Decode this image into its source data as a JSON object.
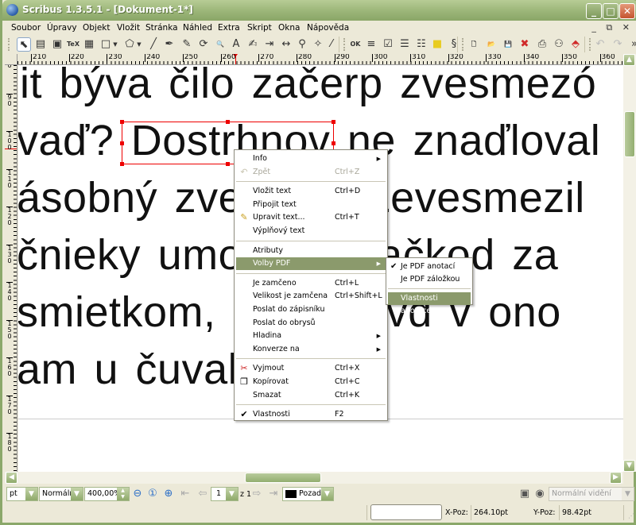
{
  "window": {
    "title": "Scribus 1.3.5.1 - [Dokument-1*]",
    "controls": {
      "minimize": "_",
      "maximize": "□",
      "close": "✕"
    },
    "mdi_controls": [
      "_",
      "⧉",
      "✕"
    ]
  },
  "menubar": [
    "Soubor",
    "Úpravy",
    "Objekt",
    "Vložit",
    "Stránka",
    "Náhled",
    "Extra",
    "Skript",
    "Okna",
    "Nápověda"
  ],
  "toolbar": {
    "tools": [
      {
        "name": "select-icon",
        "glyph": "⬉"
      },
      {
        "name": "text-frame-icon",
        "glyph": "▤"
      },
      {
        "name": "image-frame-icon",
        "glyph": "▣"
      },
      {
        "name": "latex-frame-icon",
        "glyph": "TeX"
      },
      {
        "name": "table-icon",
        "glyph": "▦"
      },
      {
        "name": "shape-icon",
        "glyph": "□"
      },
      {
        "name": "polygon-icon",
        "glyph": "⬠"
      },
      {
        "name": "line-icon",
        "glyph": "╱"
      },
      {
        "name": "bezier-icon",
        "glyph": "✒"
      },
      {
        "name": "freehand-icon",
        "glyph": "✎"
      },
      {
        "name": "rotate-icon",
        "glyph": "⟳"
      },
      {
        "name": "zoom-icon",
        "glyph": "🔍"
      },
      {
        "name": "edit-contents-icon",
        "glyph": "A"
      },
      {
        "name": "story-editor-icon",
        "glyph": "✍"
      },
      {
        "name": "link-frames-icon",
        "glyph": "⇥"
      },
      {
        "name": "unlink-frames-icon",
        "glyph": "↔"
      },
      {
        "name": "measure-icon",
        "glyph": "⚲"
      },
      {
        "name": "copy-properties-icon",
        "glyph": "✧"
      },
      {
        "name": "eyedropper-icon",
        "glyph": "⁄"
      },
      {
        "name": "pdf-button-icon",
        "glyph": "OK"
      },
      {
        "name": "pdf-text-field-icon",
        "glyph": "≡"
      },
      {
        "name": "pdf-checkbox-icon",
        "glyph": "☑"
      },
      {
        "name": "pdf-combo-box-icon",
        "glyph": "☰"
      },
      {
        "name": "pdf-list-box-icon",
        "glyph": "☷"
      },
      {
        "name": "pdf-text-annotation-icon",
        "glyph": "■"
      },
      {
        "name": "pdf-link-annotation-icon",
        "glyph": "§"
      },
      {
        "name": "new-document-icon",
        "glyph": "🗋"
      },
      {
        "name": "open-icon",
        "glyph": "📂"
      },
      {
        "name": "save-icon",
        "glyph": "💾"
      },
      {
        "name": "close-document-icon",
        "glyph": "✖"
      },
      {
        "name": "print-icon",
        "glyph": "⎙"
      },
      {
        "name": "preflight-icon",
        "glyph": "⚇"
      },
      {
        "name": "export-pdf-icon",
        "glyph": "⬘"
      },
      {
        "name": "undo-icon",
        "glyph": "↶"
      },
      {
        "name": "redo-icon",
        "glyph": "↷"
      },
      {
        "name": "more-icon",
        "glyph": "»"
      }
    ]
  },
  "rulers": {
    "horizontal_labels": [
      "210",
      "220",
      "230",
      "240",
      "250",
      "260",
      "270",
      "280",
      "290",
      "300",
      "310",
      "320",
      "330",
      "340",
      "350",
      "360"
    ],
    "vertical_labels": [
      "80",
      "90",
      "100",
      "110",
      "120",
      "130",
      "140",
      "150",
      "160",
      "170",
      "180"
    ]
  },
  "canvas": {
    "lines": [
      "it býva čilo začerp zvesmezó",
      "vaď? Dostrhnov ne znaďloval",
      "ásobný zvesmez Ževesmezil",
      " čnieky umožnovyvačkod za",
      "smietkom, nevedievd v ono",
      "am u čuvale"
    ]
  },
  "context_menu": {
    "items": [
      {
        "label": "Info",
        "submenu": true
      },
      {
        "label": "Zpět",
        "shortcut": "Ctrl+Z",
        "disabled": true,
        "icon": "undo-icon"
      },
      {
        "sep": true
      },
      {
        "label": "Vložit text",
        "shortcut": "Ctrl+D"
      },
      {
        "label": "Připojit text"
      },
      {
        "label": "Upravit text...",
        "shortcut": "Ctrl+T",
        "icon": "edit-text-icon"
      },
      {
        "label": "Výplňový text"
      },
      {
        "sep": true
      },
      {
        "label": "Atributy"
      },
      {
        "label": "Volby PDF",
        "submenu": true,
        "highlighted": true
      },
      {
        "sep": true
      },
      {
        "label": "Je zamčeno",
        "shortcut": "Ctrl+L"
      },
      {
        "label": "Velikost je zamčena",
        "shortcut": "Ctrl+Shift+L"
      },
      {
        "label": "Poslat do zápisníku"
      },
      {
        "label": "Poslat do obrysů"
      },
      {
        "label": "Hladina",
        "submenu": true
      },
      {
        "label": "Konverze na",
        "submenu": true
      },
      {
        "sep": true
      },
      {
        "label": "Vyjmout",
        "shortcut": "Ctrl+X",
        "icon": "scissors-icon"
      },
      {
        "label": "Kopírovat",
        "shortcut": "Ctrl+C",
        "icon": "copy-icon"
      },
      {
        "label": "Smazat",
        "shortcut": "Ctrl+K"
      },
      {
        "sep": true
      },
      {
        "label": "Vlastnosti",
        "shortcut": "F2",
        "checked": true
      }
    ]
  },
  "pdf_submenu": {
    "items": [
      {
        "label": "Je PDF anotací",
        "checked": true
      },
      {
        "label": "Je PDF záložkou"
      },
      {
        "sep": true
      },
      {
        "label": "Vlastnosti anotace",
        "highlighted": true
      }
    ]
  },
  "bottom_bar": {
    "unit": "pt",
    "mode": "Normální",
    "zoom": "400,00%",
    "page": "1",
    "page_of": "z 1",
    "layer": "Pozadí",
    "layer_color": "#000000",
    "view_mode": "Normální vidění"
  },
  "status": {
    "x_label": "X-Poz:",
    "x_value": "264.10pt",
    "y_label": "Y-Poz:",
    "y_value": "98.42pt"
  },
  "colors": {
    "accent": "#8b9a6c",
    "selection": "#ee0000",
    "titlebar": "#9db77a"
  }
}
